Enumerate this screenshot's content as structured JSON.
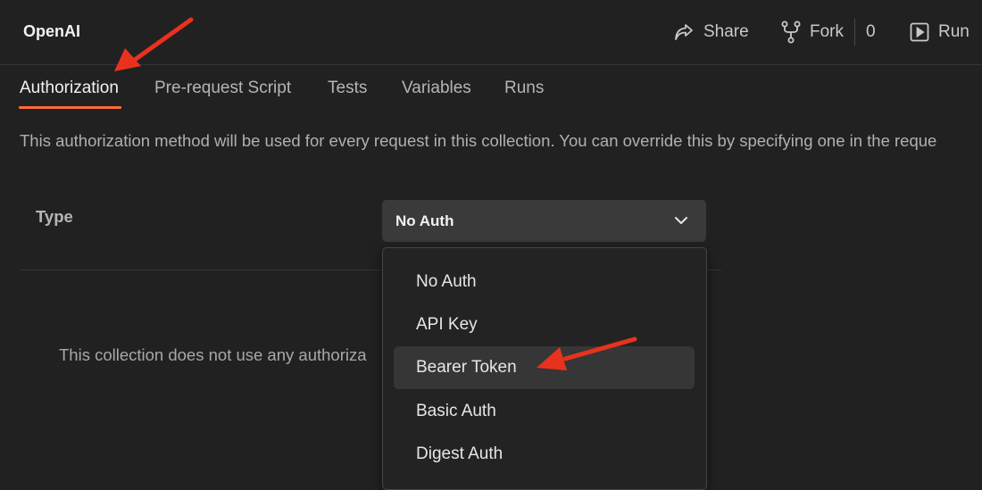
{
  "header": {
    "title": "OpenAI",
    "share_label": "Share",
    "fork_label": "Fork",
    "fork_count": "0",
    "run_label": "Run"
  },
  "tabs": [
    {
      "label": "Authorization",
      "active": true
    },
    {
      "label": "Pre-request Script"
    },
    {
      "label": "Tests"
    },
    {
      "label": "Variables"
    },
    {
      "label": "Runs"
    }
  ],
  "auth": {
    "description": "This authorization method will be used for every request in this collection. You can override this by specifying one in the reque",
    "type_label": "Type",
    "selected": "No Auth",
    "no_auth_message": "This collection does not use any authoriza",
    "options": [
      "No Auth",
      "API Key",
      "Bearer Token",
      "Basic Auth",
      "Digest Auth"
    ],
    "highlighted_option": "Bearer Token"
  },
  "colors": {
    "accent": "#ff6c37",
    "annotation_arrow": "#e8321e",
    "background": "#212121"
  },
  "icons": [
    "share-icon",
    "fork-icon",
    "run-icon",
    "chevron-down-icon"
  ]
}
